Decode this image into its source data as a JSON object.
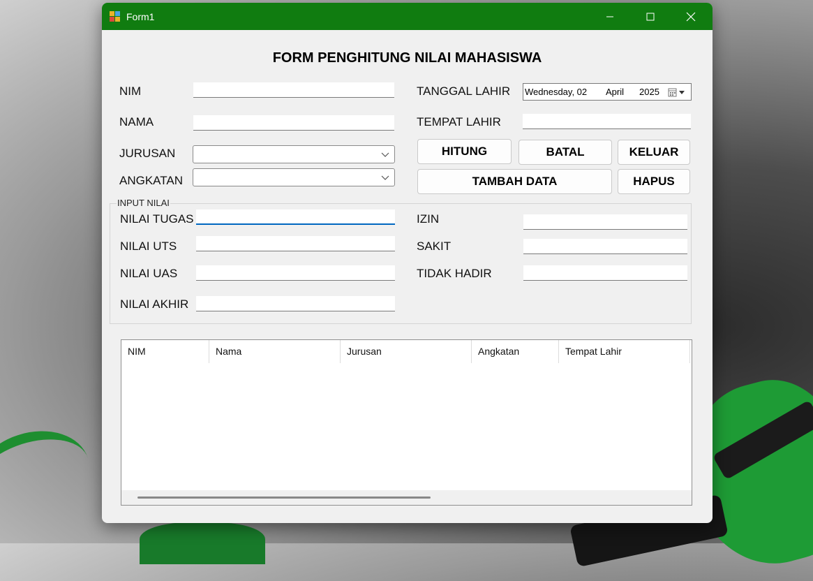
{
  "window": {
    "title": "Form1"
  },
  "form": {
    "heading": "FORM PENGHITUNG NILAI MAHASISWA"
  },
  "labels": {
    "nim": "NIM",
    "nama": "NAMA",
    "jurusan": "JURUSAN",
    "angkatan": "ANGKATAN",
    "tanggal_lahir": "TANGGAL LAHIR",
    "tempat_lahir": "TEMPAT LAHIR",
    "nilai_tugas": "NILAI TUGAS",
    "nilai_uts": "NILAI UTS",
    "nilai_uas": "NILAI UAS",
    "nilai_akhir": "NILAI AKHIR",
    "izin": "IZIN",
    "sakit": "SAKIT",
    "tidak_hadir": "TIDAK HADIR"
  },
  "date_picker": {
    "weekday": "Wednesday, 02",
    "month": "April",
    "year": "2025"
  },
  "buttons": {
    "hitung": "HITUNG",
    "batal": "BATAL",
    "keluar": "KELUAR",
    "tambah_data": "TAMBAH DATA",
    "hapus": "HAPUS"
  },
  "group": {
    "legend": "INPUT NILAI"
  },
  "grid": {
    "columns": [
      "NIM",
      "Nama",
      "Jurusan",
      "Angkatan",
      "Tempat Lahir"
    ]
  },
  "colors": {
    "titlebar": "#107c10",
    "focus": "#0067c0"
  }
}
